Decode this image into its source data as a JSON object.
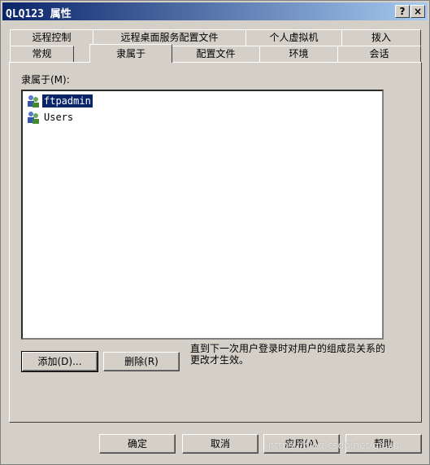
{
  "window": {
    "title": "QLQ123 属性"
  },
  "titlebar_buttons": {
    "help": "?",
    "close": "×"
  },
  "tabs_row1": [
    "远程控制",
    "远程桌面服务配置文件",
    "个人虚拟机",
    "拨入"
  ],
  "tabs_row2": [
    "常规",
    "隶属于",
    "配置文件",
    "环境",
    "会话"
  ],
  "active_tab": "隶属于",
  "panel": {
    "label": "隶属于(M):",
    "members": [
      {
        "name": "ftpadmin",
        "icon": "group-icon",
        "selected": true
      },
      {
        "name": "Users",
        "icon": "group-icon",
        "selected": false
      }
    ],
    "add_label": "添加(D)...",
    "remove_label": "删除(R)",
    "note": "直到下一次用户登录时对用户的组成员关系的更改才生效。"
  },
  "footer": {
    "ok": "确定",
    "cancel": "取消",
    "apply": "应用(A)",
    "help": "帮助"
  },
  "watermark": "https://blog.csdn.net/qiuliu",
  "colors": {
    "face": "#d4d0c8",
    "titlebar": "#0a246a",
    "selection": "#0a246a"
  }
}
